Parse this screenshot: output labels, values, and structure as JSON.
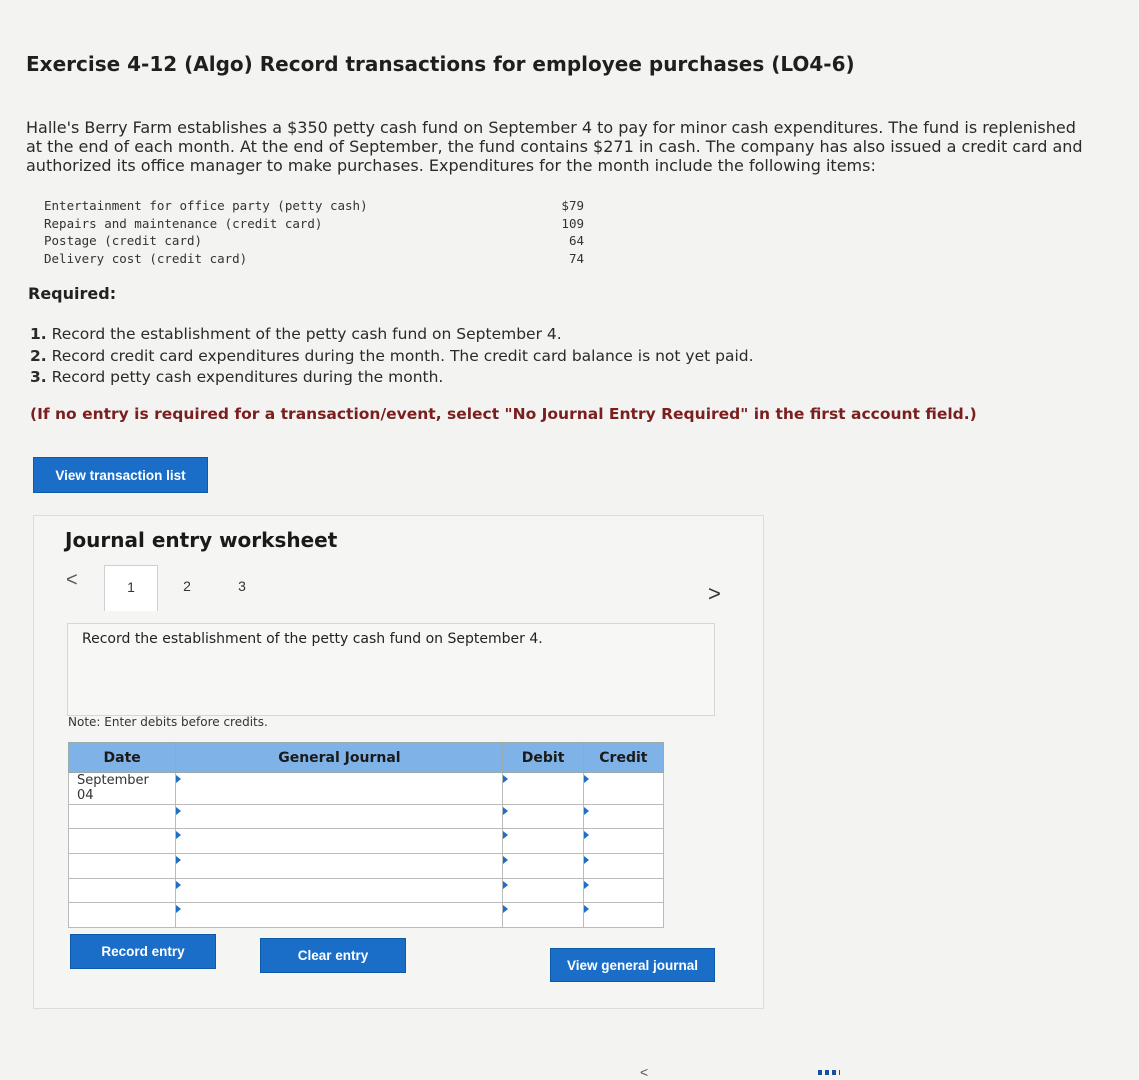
{
  "title": "Exercise 4-12 (Algo) Record transactions for employee purchases (LO4-6)",
  "intro": "Halle's Berry Farm establishes a $350 petty cash fund on September 4 to pay for minor cash expenditures. The fund is replenished at the end of each month. At the end of September, the fund contains $271 in cash. The company has also issued a credit card and authorized its office manager to make purchases. Expenditures for the month include the following items:",
  "items": [
    {
      "label": "Entertainment for office party (petty cash)",
      "amount": "$79"
    },
    {
      "label": "Repairs and maintenance (credit card)",
      "amount": "109"
    },
    {
      "label": "Postage (credit card)",
      "amount": "64"
    },
    {
      "label": "Delivery cost (credit card)",
      "amount": "74"
    }
  ],
  "required_label": "Required:",
  "requirements": [
    {
      "num": "1.",
      "text": "Record the establishment of the petty cash fund on September 4."
    },
    {
      "num": "2.",
      "text": "Record credit card expenditures during the month. The credit card balance is not yet paid."
    },
    {
      "num": "3.",
      "text": "Record petty cash expenditures during the month."
    }
  ],
  "note_required": "(If no entry is required for a transaction/event, select \"No Journal Entry Required\" in the first account field.)",
  "view_transaction_list": "View transaction list",
  "worksheet": {
    "title": "Journal entry worksheet",
    "prev": "<",
    "next": ">",
    "tabs": [
      "1",
      "2",
      "3"
    ],
    "instruction": "Record the establishment of the petty cash fund on September 4.",
    "note": "Note: Enter debits before credits.",
    "headers": {
      "date": "Date",
      "journal": "General Journal",
      "debit": "Debit",
      "credit": "Credit"
    },
    "first_date": "September 04",
    "record_entry": "Record entry",
    "clear_entry": "Clear entry",
    "view_general_journal": "View general journal"
  },
  "pager": {
    "prev": "<"
  }
}
